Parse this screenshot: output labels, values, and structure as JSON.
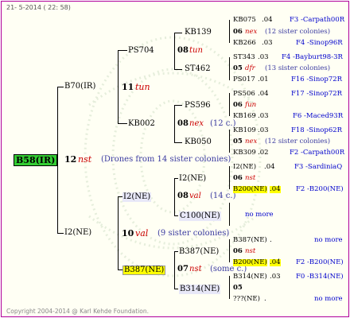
{
  "header": "21- 5-2014 ( 22: 58)",
  "footer": "Copyright 2004-2014 @ Karl Kehde Foundation.",
  "colors": {
    "border": "#b0009a",
    "root_bg": "#33cc33",
    "highlight": "#ffff00",
    "red_text": "#cc0000",
    "blue_text": "#0000cc"
  },
  "root": {
    "label": "B58(IR)",
    "year": "12",
    "mark": "nst",
    "note": "(Drones from 14 sister colonies)"
  },
  "g1_top": {
    "label": "B70(IR)",
    "year": "11",
    "mark": "tun"
  },
  "g1_bot": {
    "label": "I2(NE)",
    "year": "10",
    "mark": "val",
    "note": "(9 sister colonies)"
  },
  "g2": {
    "ps704": {
      "label": "PS704",
      "year": "08",
      "mark": "tun"
    },
    "kb002": {
      "label": "KB002",
      "year": "08",
      "mark": "nex",
      "note": "(12 c.)"
    },
    "i2ne": {
      "label": "I2(NE)",
      "year": "08",
      "mark": "val",
      "note": "(14 c.)"
    },
    "b387": {
      "label": "B387(NE)",
      "year": "07",
      "mark": "nst",
      "note": "(some c.)"
    }
  },
  "g3": {
    "kb139": "KB139",
    "st462": "ST462",
    "ps596": "PS596",
    "kb050": "KB050",
    "i2ne": "I2(NE)",
    "c100": "C100(NE)",
    "b387": "B387(NE)",
    "b314": "B314(NE)"
  },
  "g4": [
    {
      "label": "KB075",
      "suffix": ".04",
      "info": "F3 -Carpath00R"
    },
    {
      "label": "06",
      "mark": "nex",
      "note": "(12 sister colonies)"
    },
    {
      "label": "KB266",
      "suffix": ".03",
      "info": "F4 -Sinop96R"
    },
    {
      "label": "ST343",
      "suffix": ".03",
      "info": "F4 -Bayburt98-3R"
    },
    {
      "label": "05",
      "mark": "dfr",
      "note": "(13 sister colonies)"
    },
    {
      "label": "PS017",
      "suffix": ".01",
      "info": "F16 -Sinop72R"
    },
    {
      "label": "PS506",
      "suffix": ".04",
      "info": "F17 -Sinop72R"
    },
    {
      "label": "06",
      "mark": "fun"
    },
    {
      "label": "KB169",
      "suffix": ".03",
      "info": "F6 -Maced93R"
    },
    {
      "label": "KB109",
      "suffix": ".03",
      "info": "F18 -Sinop62R"
    },
    {
      "label": "05",
      "mark": "nex",
      "note": "(12 sister colonies)"
    },
    {
      "label": "KB309",
      "suffix": ".02",
      "info": "F2 -Carpath00R"
    },
    {
      "label": "I2(NE)",
      "suffix": ".04",
      "info": "F3 -SardiniaQ"
    },
    {
      "label": "06",
      "mark": "nst"
    },
    {
      "label": "B200(NE)",
      "suffix": ".04",
      "info": "F2 -B200(NE)"
    },
    {
      "label": "no more"
    },
    {
      "label": "B387(NE)",
      "suffix": ".",
      "info": "no more"
    },
    {
      "label": "06",
      "mark": "nst"
    },
    {
      "label": "B200(NE)",
      "suffix": ".04",
      "info": "F2 -B200(NE)"
    },
    {
      "label": "B314(NE)",
      "suffix": ".03",
      "info": "F0 -B314(NE)"
    },
    {
      "label": "05"
    },
    {
      "label": "???(NE)",
      "suffix": ".",
      "info": "no more"
    }
  ]
}
